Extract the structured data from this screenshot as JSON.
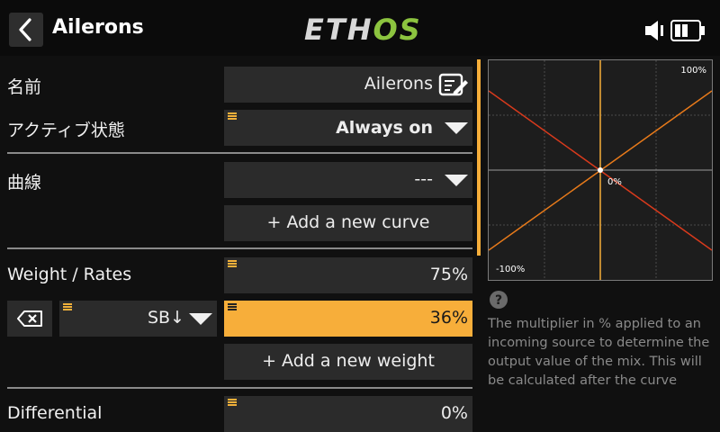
{
  "header": {
    "title": "Ailerons",
    "logo_main": "ETH",
    "logo_accent": "OS"
  },
  "rows": {
    "name": {
      "label": "名前",
      "value": "Ailerons"
    },
    "active_state": {
      "label": "アクティブ状態",
      "value": "Always on"
    },
    "curve": {
      "label": "曲線",
      "value": "---",
      "add_button": "+ Add a new curve"
    },
    "weight": {
      "label": "Weight / Rates",
      "value": "75%",
      "switch": "SB↓",
      "switch_weight": "36%",
      "add_button": "+ Add a new weight"
    },
    "differential": {
      "label": "Differential",
      "value": "0%"
    }
  },
  "graph": {
    "max_label": "100%",
    "min_label": "-100%",
    "center_label": "0%"
  },
  "help": {
    "icon": "question-icon",
    "text": "The multiplier in % applied to an incoming source to determine the output value of the mix. This will be calculated after the curve"
  },
  "colors": {
    "accent": "#f7ae3a",
    "curve_line": "#d93a1c",
    "output_line": "#e87a1a",
    "logo_green": "#8cc43f"
  }
}
